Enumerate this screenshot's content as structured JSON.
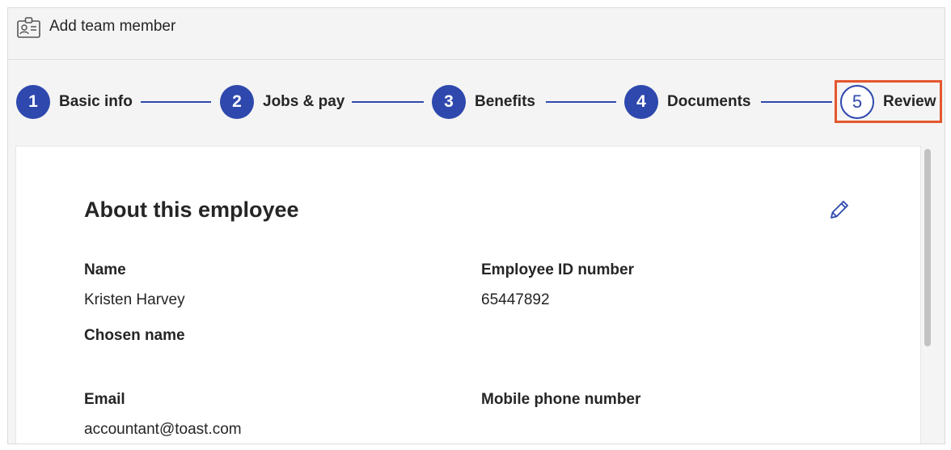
{
  "header": {
    "title": "Add team member",
    "icon": "id-badge-icon"
  },
  "stepper": {
    "accent_color": "#2e48ad",
    "highlight_color": "#e4572e",
    "steps": [
      {
        "number": "1",
        "label": "Basic info",
        "state": "complete"
      },
      {
        "number": "2",
        "label": "Jobs & pay",
        "state": "complete"
      },
      {
        "number": "3",
        "label": "Benefits",
        "state": "complete"
      },
      {
        "number": "4",
        "label": "Documents",
        "state": "complete"
      },
      {
        "number": "5",
        "label": "Review",
        "state": "current"
      }
    ]
  },
  "section": {
    "title": "About this employee",
    "edit_icon": "pencil-icon",
    "fields": {
      "name": {
        "label": "Name",
        "value": "Kristen Harvey"
      },
      "chosen_name": {
        "label": "Chosen name",
        "value": ""
      },
      "email": {
        "label": "Email",
        "value": "accountant@toast.com"
      },
      "employee_id": {
        "label": "Employee ID number",
        "value": "65447892"
      },
      "mobile_phone": {
        "label": "Mobile phone number",
        "value": ""
      }
    }
  }
}
